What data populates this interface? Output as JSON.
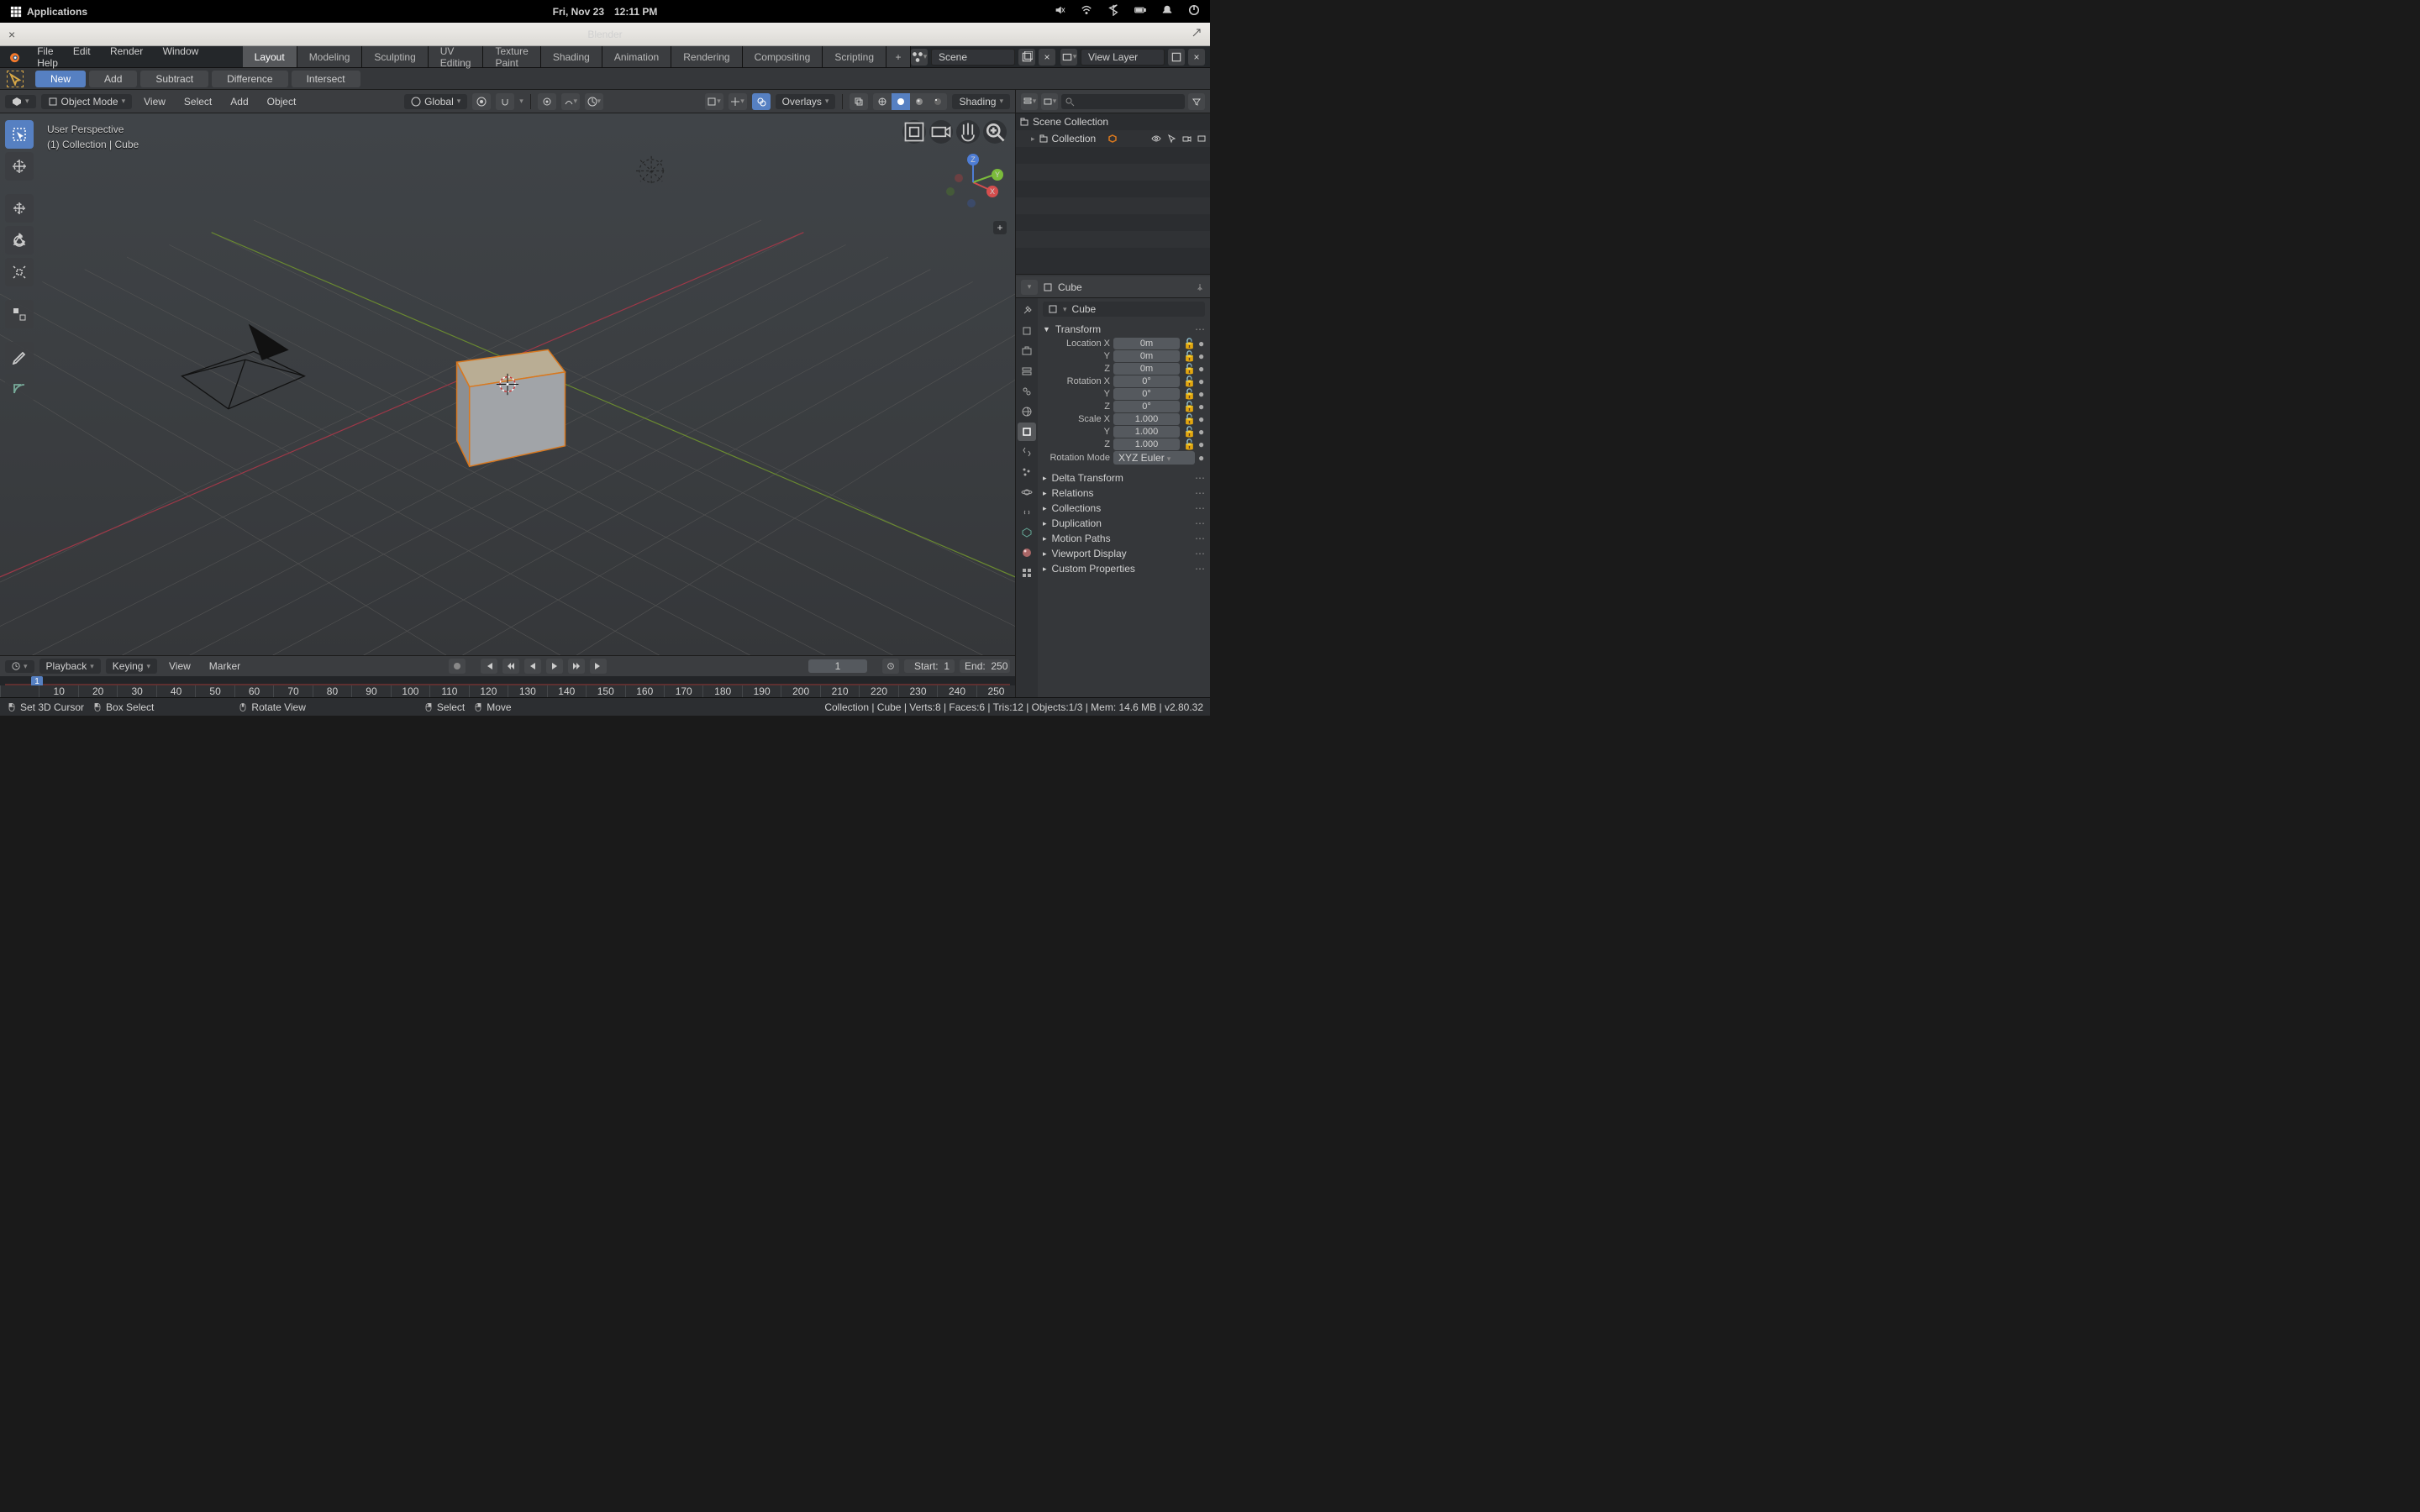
{
  "gnome": {
    "apps": "Applications",
    "date": "Fri, Nov 23",
    "time": "12:11 PM"
  },
  "window": {
    "title": "Blender"
  },
  "menu": {
    "items": [
      "File",
      "Edit",
      "Render",
      "Window",
      "Help"
    ]
  },
  "tabs": [
    "Layout",
    "Modeling",
    "Sculpting",
    "UV Editing",
    "Texture Paint",
    "Shading",
    "Animation",
    "Rendering",
    "Compositing",
    "Scripting"
  ],
  "scene_field": "Scene",
  "layer_field": "View Layer",
  "toolhdr": [
    "New",
    "Add",
    "Subtract",
    "Difference",
    "Intersect"
  ],
  "vphdr": {
    "mode": "Object Mode",
    "menus": [
      "View",
      "Select",
      "Add",
      "Object"
    ],
    "orient": "Global",
    "overlays": "Overlays",
    "shading": "Shading"
  },
  "vp_overlay": {
    "line1": "User Perspective",
    "line2": "(1) Collection | Cube"
  },
  "outliner": {
    "root": "Scene Collection",
    "coll": "Collection"
  },
  "props": {
    "obj": "Cube",
    "name": "Cube",
    "section_transform": "Transform",
    "loc_lbl": "Location X",
    "loc": [
      "0m",
      "0m",
      "0m"
    ],
    "rot_lbl": "Rotation X",
    "rot": [
      "0°",
      "0°",
      "0°"
    ],
    "scl_lbl": "Scale X",
    "scl": [
      "1.000",
      "1.000",
      "1.000"
    ],
    "rotmode_lbl": "Rotation Mode",
    "rotmode": "XYZ Euler",
    "sections": [
      "Delta Transform",
      "Relations",
      "Collections",
      "Duplication",
      "Motion Paths",
      "Viewport Display",
      "Custom Properties"
    ]
  },
  "timeline": {
    "menus": [
      "Playback",
      "Keying"
    ],
    "links": [
      "View",
      "Marker"
    ],
    "current": "1",
    "start_lbl": "Start:",
    "start": "1",
    "end_lbl": "End:",
    "end": "250",
    "ticks": [
      "10",
      "20",
      "30",
      "40",
      "50",
      "60",
      "70",
      "80",
      "90",
      "100",
      "110",
      "120",
      "130",
      "140",
      "150",
      "160",
      "170",
      "180",
      "190",
      "200",
      "210",
      "220",
      "230",
      "240",
      "250"
    ]
  },
  "status": {
    "a": "Set 3D Cursor",
    "b": "Box Select",
    "c": "Rotate View",
    "d": "Select",
    "e": "Move",
    "right": "Collection | Cube | Verts:8 | Faces:6 | Tris:12 | Objects:1/3 | Mem: 14.6 MB | v2.80.32"
  }
}
